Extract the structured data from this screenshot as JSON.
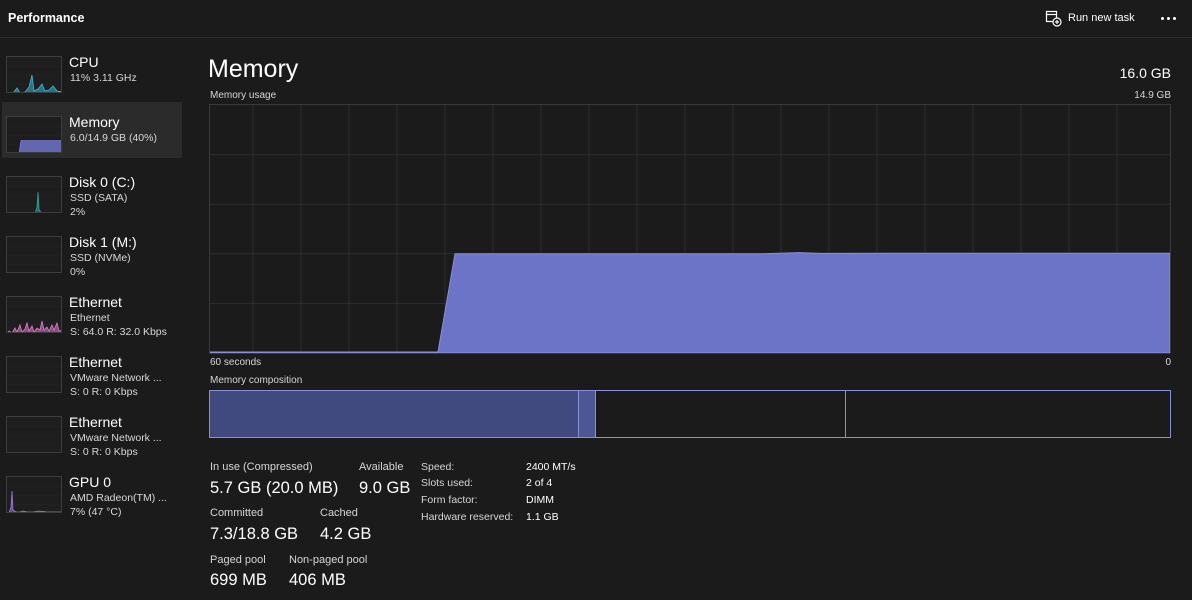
{
  "app": {
    "title": "Performance",
    "run_new_task": "Run new task",
    "more_icon": "more-horizontal-icon"
  },
  "sidebar": {
    "items": [
      {
        "name": "CPU",
        "line1": "11% 3.11 GHz",
        "line2": "",
        "color": "#39b8d8",
        "selected": false
      },
      {
        "name": "Memory",
        "line1": "6.0/14.9 GB (40%)",
        "line2": "",
        "color": "#7b80e0",
        "selected": true,
        "level": 0.4
      },
      {
        "name": "Disk 0 (C:)",
        "line1": "SSD (SATA)",
        "line2": "2%",
        "color": "#2aa8a0",
        "selected": false
      },
      {
        "name": "Disk 1 (M:)",
        "line1": "SSD (NVMe)",
        "line2": "0%",
        "color": "#2aa8a0",
        "selected": false
      },
      {
        "name": "Ethernet",
        "line1": "Ethernet",
        "line2": "S: 64.0 R: 32.0 Kbps",
        "color": "#e07ad0",
        "selected": false
      },
      {
        "name": "Ethernet",
        "line1": "VMware Network ...",
        "line2": "S: 0 R: 0 Kbps",
        "color": "#e07ad0",
        "selected": false
      },
      {
        "name": "Ethernet",
        "line1": "VMware Network ...",
        "line2": "S: 0 R: 0 Kbps",
        "color": "#e07ad0",
        "selected": false
      },
      {
        "name": "GPU 0",
        "line1": "AMD Radeon(TM) ...",
        "line2": "7% (47 °C)",
        "color": "#a07ae0",
        "selected": false
      }
    ]
  },
  "main": {
    "title": "Memory",
    "total": "16.0 GB",
    "usage_label": "Memory usage",
    "usage_max": "14.9 GB",
    "time_label": "60 seconds",
    "time_end": "0",
    "composition_label": "Memory composition",
    "usage_level": 0.4,
    "composition": {
      "in_use": 0.383,
      "modified": 0.019,
      "standby": 0.26,
      "free": 0.338
    }
  },
  "stats": {
    "in_use_label": "In use (Compressed)",
    "in_use_value": "5.7 GB (20.0 MB)",
    "available_label": "Available",
    "available_value": "9.0 GB",
    "committed_label": "Committed",
    "committed_value": "7.3/18.8 GB",
    "cached_label": "Cached",
    "cached_value": "4.2 GB",
    "paged_label": "Paged pool",
    "paged_value": "699 MB",
    "nonpaged_label": "Non-paged pool",
    "nonpaged_value": "406 MB"
  },
  "specs": [
    {
      "label": "Speed:",
      "value": "2400 MT/s"
    },
    {
      "label": "Slots used:",
      "value": "2 of 4"
    },
    {
      "label": "Form factor:",
      "value": "DIMM"
    },
    {
      "label": "Hardware reserved:",
      "value": "1.1 GB"
    }
  ],
  "colors": {
    "accent": "#6b74c7",
    "accent_border": "#8b8fd6",
    "background": "#1b1b1b"
  }
}
